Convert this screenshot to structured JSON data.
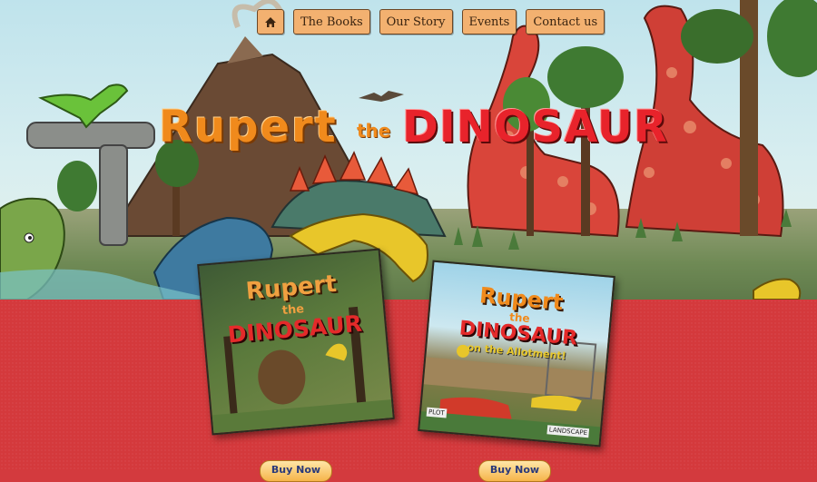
{
  "nav": {
    "home_icon": "home-icon",
    "items": [
      {
        "label": "The Books"
      },
      {
        "label": "Our Story"
      },
      {
        "label": "Events"
      },
      {
        "label": "Contact us"
      }
    ]
  },
  "hero": {
    "title_word1": "Rupert",
    "title_word2": "the",
    "title_word3": "DINOSAUR"
  },
  "books": [
    {
      "title_line1": "Rupert",
      "title_line2": "the",
      "title_line3": "DINOSAUR",
      "buy_label": "Buy Now"
    },
    {
      "title_line1": "Rupert",
      "title_line2": "the",
      "title_line3": "DINOSAUR",
      "subtitle": "on the Allotment!",
      "badge1": "PLOT",
      "badge2": "LANDSCAPE",
      "buy_label": "Buy Now"
    }
  ],
  "colors": {
    "nav_button": "#f3b170",
    "page_red": "#d4393c",
    "title_orange": "#f08a1c",
    "title_red": "#e8232b"
  }
}
